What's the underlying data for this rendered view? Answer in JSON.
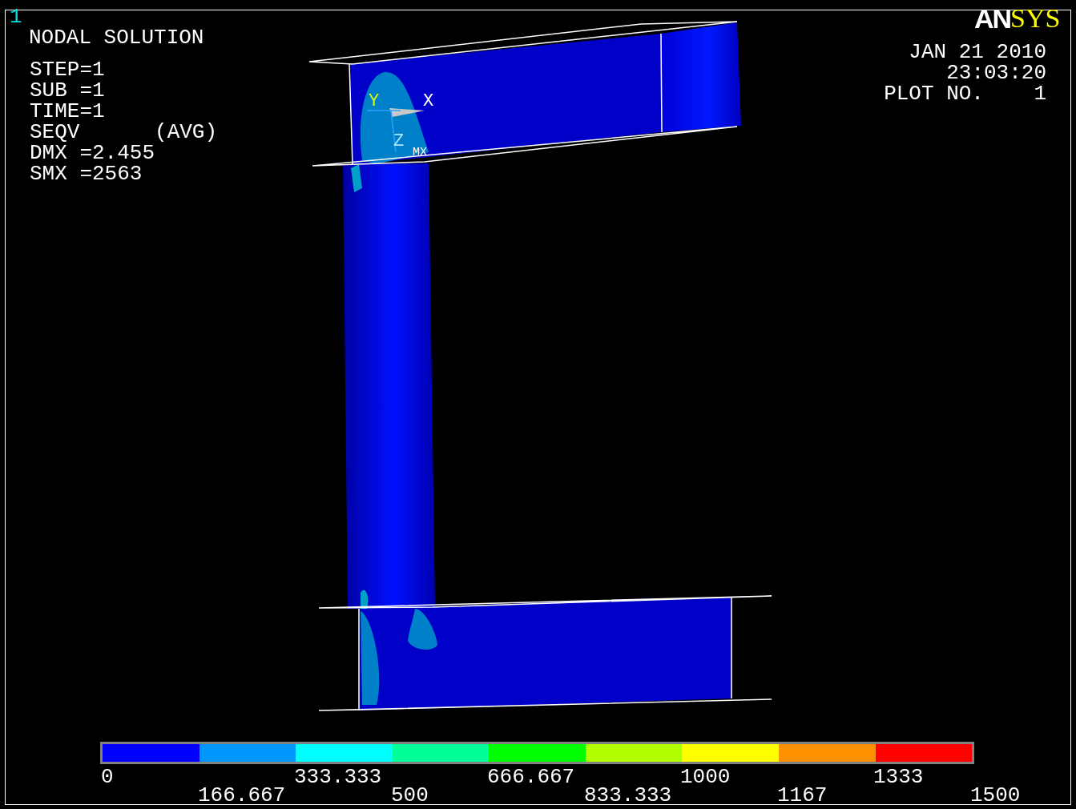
{
  "viewport_number": "1",
  "title": "NODAL SOLUTION",
  "info": [
    "STEP=1",
    "SUB =1",
    "TIME=1",
    "SEQV      (AVG)",
    "DMX =2.455",
    "SMX =2563"
  ],
  "logo": {
    "part_1": "AN",
    "part_2": "SYS"
  },
  "stamp": [
    "JAN 21 2010",
    "23:03:20",
    "PLOT NO.    1"
  ],
  "triad": {
    "x": "X",
    "y": "Y",
    "z": "Z"
  },
  "max_marker": "MX",
  "legend": {
    "bands": [
      {
        "color": "#0000ff"
      },
      {
        "color": "#0098ff"
      },
      {
        "color": "#00ffff"
      },
      {
        "color": "#00ff98"
      },
      {
        "color": "#00ff00"
      },
      {
        "color": "#b2ff00"
      },
      {
        "color": "#ffff00"
      },
      {
        "color": "#ff9000"
      },
      {
        "color": "#ff0000"
      }
    ],
    "labels": [
      "0",
      "166.667",
      "333.333",
      "500",
      "666.667",
      "833.333",
      "1000",
      "1167",
      "1333",
      "1500"
    ]
  }
}
